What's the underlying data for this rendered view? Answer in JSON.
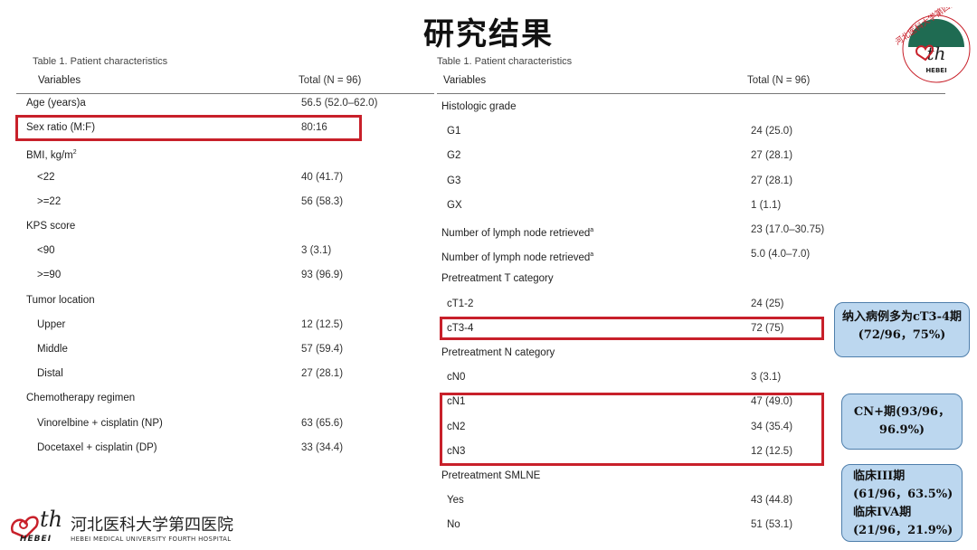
{
  "title": "研究结果",
  "left_table": {
    "caption": "Table 1. Patient characteristics",
    "header": {
      "variable": "Variables",
      "total": "Total (N = 96)"
    },
    "rows": [
      {
        "label": "Age (years)a",
        "value": "56.5 (52.0–62.0)"
      },
      {
        "label": "Sex ratio (M:F)",
        "value": "80:16"
      },
      {
        "label": "BMI, kg/m",
        "sup": "2",
        "value": ""
      },
      {
        "label": "<22",
        "value": "40 (41.7)"
      },
      {
        "label": ">=22",
        "value": "56 (58.3)"
      },
      {
        "label": "KPS score",
        "value": ""
      },
      {
        "label": "<90",
        "value": "3 (3.1)"
      },
      {
        "label": ">=90",
        "value": "93 (96.9)"
      },
      {
        "label": "Tumor location",
        "value": ""
      },
      {
        "label": "Upper",
        "value": "12 (12.5)"
      },
      {
        "label": "Middle",
        "value": "57 (59.4)"
      },
      {
        "label": "Distal",
        "value": "27 (28.1)"
      },
      {
        "label": "Chemotherapy regimen",
        "value": ""
      },
      {
        "label": "Vinorelbine + cisplatin (NP)",
        "value": "63 (65.6)"
      },
      {
        "label": "Docetaxel + cisplatin (DP)",
        "value": "33 (34.4)"
      }
    ]
  },
  "right_table": {
    "caption": "Table 1. Patient characteristics",
    "header": {
      "variable": "Variables",
      "total": "Total (N = 96)"
    },
    "rows": [
      {
        "label": "Histologic grade",
        "value": ""
      },
      {
        "label": "G1",
        "value": "24 (25.0)"
      },
      {
        "label": "G2",
        "value": "27 (28.1)"
      },
      {
        "label": "G3",
        "value": "27 (28.1)"
      },
      {
        "label": "GX",
        "value": "1 (1.1)"
      },
      {
        "label": "Number of lymph node retrieved",
        "sup": "a",
        "value": "23 (17.0–30.75)"
      },
      {
        "label": "Number of lymph node retrieved",
        "sup": "a",
        "value": "5.0 (4.0–7.0)"
      },
      {
        "label": "Pretreatment T category",
        "value": ""
      },
      {
        "label": "cT1-2",
        "value": "24 (25)"
      },
      {
        "label": "cT3-4",
        "value": "72 (75)"
      },
      {
        "label": "Pretreatment N category",
        "value": ""
      },
      {
        "label": "cN0",
        "value": "3 (3.1)"
      },
      {
        "label": "cN1",
        "value": "47 (49.0)"
      },
      {
        "label": "cN2",
        "value": "34 (35.4)"
      },
      {
        "label": "cN3",
        "value": "12 (12.5)"
      },
      {
        "label": "Pretreatment SMLNE",
        "value": ""
      },
      {
        "label": "Yes",
        "value": "43 (44.8)"
      },
      {
        "label": "No",
        "value": "51 (53.1)"
      }
    ]
  },
  "notes": {
    "ct": {
      "line1": "纳入病例多为cT3-4期",
      "line2": "(72/96，75%)"
    },
    "cn": {
      "line1": "CN+期(93/96，",
      "line2": "96.9%)"
    },
    "stage": {
      "line1": "临床III期",
      "line2": "(61/96，63.5%)",
      "line3": "临床IVA期",
      "line4": "(21/96，21.9%)"
    }
  },
  "logo": {
    "cn_name": "河北医科大学第四医院",
    "en_name": "HEBEI MEDICAL UNIVERSITY FOURTH HOSPITAL",
    "mark": "th",
    "sub": "HEBEI",
    "ring_text": "河北医科大学第四医院",
    "colors": {
      "red": "#c8202a",
      "green": "#1f6b52"
    }
  }
}
